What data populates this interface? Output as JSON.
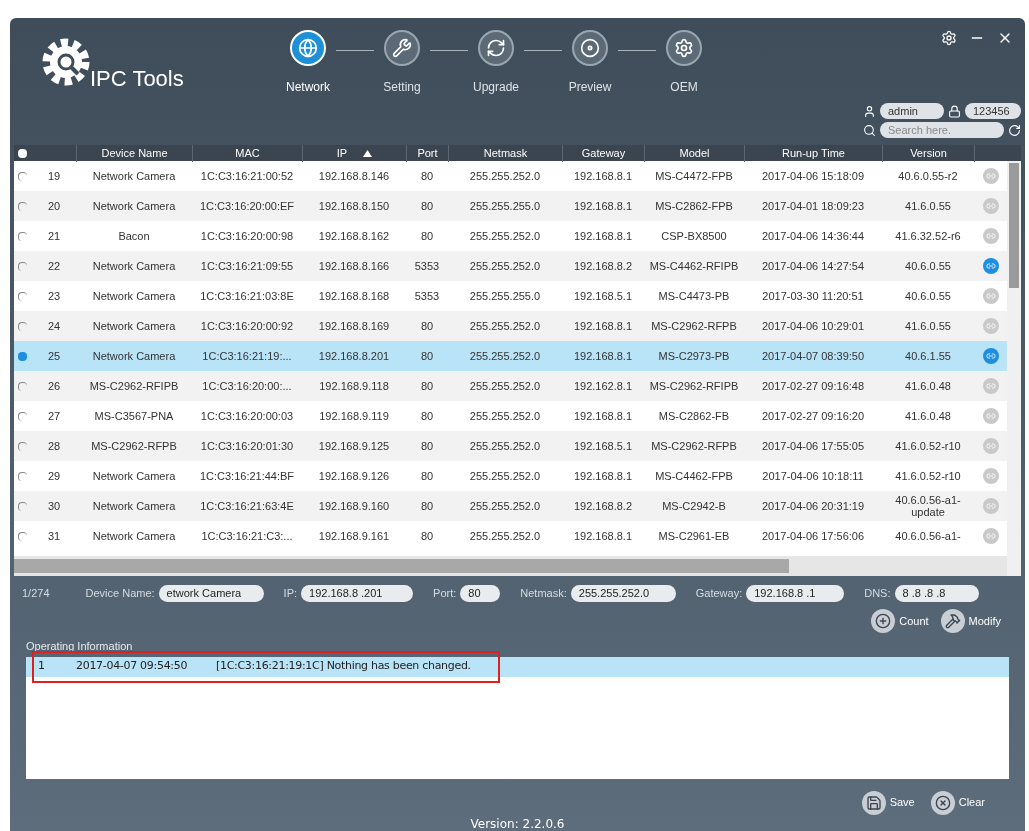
{
  "app": {
    "title": "IPC Tools"
  },
  "steps": [
    {
      "label": "Network",
      "selected": true,
      "kind": "globe"
    },
    {
      "label": "Setting",
      "selected": false,
      "kind": "tools"
    },
    {
      "label": "Upgrade",
      "selected": false,
      "kind": "cycle"
    },
    {
      "label": "Preview",
      "selected": false,
      "kind": "disc"
    },
    {
      "label": "OEM",
      "selected": false,
      "kind": "oem"
    }
  ],
  "login": {
    "username": "admin",
    "password": "123456"
  },
  "search": {
    "placeholder": "Search here."
  },
  "table": {
    "select_all": {
      "checked": false
    },
    "columns": [
      {
        "label": "Device Name",
        "sorted": false
      },
      {
        "label": "MAC",
        "sorted": false
      },
      {
        "label": "IP",
        "sorted": true
      },
      {
        "label": "Port",
        "sorted": false
      },
      {
        "label": "Netmask",
        "sorted": false
      },
      {
        "label": "Gateway",
        "sorted": false
      },
      {
        "label": "Model",
        "sorted": false
      },
      {
        "label": "Run-up Time",
        "sorted": false
      },
      {
        "label": "Version",
        "sorted": false
      }
    ],
    "rows": [
      {
        "no": "19",
        "cells": [
          "Network Camera",
          "1C:C3:16:21:00:52",
          "192.168.8.146",
          "80",
          "255.255.252.0",
          "192.168.8.1",
          "MS-C4472-FPB",
          "2017-04-06 15:18:09",
          "40.6.0.55-r2"
        ],
        "checked": false,
        "selected": false,
        "active": false
      },
      {
        "no": "20",
        "cells": [
          "Network Camera",
          "1C:C3:16:20:00:EF",
          "192.168.8.150",
          "80",
          "255.255.255.0",
          "192.168.8.1",
          "MS-C2862-FPB",
          "2017-04-01 18:09:23",
          "41.6.0.55"
        ],
        "checked": false,
        "selected": false,
        "active": false
      },
      {
        "no": "21",
        "cells": [
          "Bacon",
          "1C:C3:16:20:00:98",
          "192.168.8.162",
          "80",
          "255.255.252.0",
          "192.168.8.1",
          "CSP-BX8500",
          "2017-04-06 14:36:44",
          "41.6.32.52-r6"
        ],
        "checked": false,
        "selected": false,
        "active": false
      },
      {
        "no": "22",
        "cells": [
          "Network Camera",
          "1C:C3:16:21:09:55",
          "192.168.8.166",
          "5353",
          "255.255.252.0",
          "192.168.8.2",
          "MS-C4462-RFIPB",
          "2017-04-06 14:27:54",
          "40.6.0.55"
        ],
        "checked": false,
        "selected": false,
        "active": true
      },
      {
        "no": "23",
        "cells": [
          "Network Camera",
          "1C:C3:16:21:03:8E",
          "192.168.8.168",
          "5353",
          "255.255.255.0",
          "192.168.5.1",
          "MS-C4473-PB",
          "2017-03-30 11:20:51",
          "40.6.0.55"
        ],
        "checked": false,
        "selected": false,
        "active": false
      },
      {
        "no": "24",
        "cells": [
          "Network Camera",
          "1C:C3:16:20:00:92",
          "192.168.8.169",
          "80",
          "255.255.252.0",
          "192.168.8.1",
          "MS-C2962-RFPB",
          "2017-04-06 10:29:01",
          "41.6.0.55"
        ],
        "checked": false,
        "selected": false,
        "active": false
      },
      {
        "no": "25",
        "cells": [
          "Network Camera",
          "1C:C3:16:21:19:...",
          "192.168.8.201",
          "80",
          "255.255.252.0",
          "192.168.8.1",
          "MS-C2973-PB",
          "2017-04-07 08:39:50",
          "40.6.1.55"
        ],
        "checked": true,
        "selected": true,
        "active": true
      },
      {
        "no": "26",
        "cells": [
          "MS-C2962-RFIPB",
          "1C:C3:16:20:00:...",
          "192.168.9.118",
          "80",
          "255.255.252.0",
          "192.162.8.1",
          "MS-C2962-RFIPB",
          "2017-02-27 09:16:48",
          "41.6.0.48"
        ],
        "checked": false,
        "selected": false,
        "active": false
      },
      {
        "no": "27",
        "cells": [
          "MS-C3567-PNA",
          "1C:C3:16:20:00:03",
          "192.168.9.119",
          "80",
          "255.255.252.0",
          "192.168.8.1",
          "MS-C2862-FB",
          "2017-02-27 09:16:20",
          "41.6.0.48"
        ],
        "checked": false,
        "selected": false,
        "active": false
      },
      {
        "no": "28",
        "cells": [
          "MS-C2962-RFPB",
          "1C:C3:16:20:01:30",
          "192.168.9.125",
          "80",
          "255.255.252.0",
          "192.168.5.1",
          "MS-C2962-RFPB",
          "2017-04-06 17:55:05",
          "41.6.0.52-r10"
        ],
        "checked": false,
        "selected": false,
        "active": false
      },
      {
        "no": "29",
        "cells": [
          "Network Camera",
          "1C:C3:16:21:44:BF",
          "192.168.9.126",
          "80",
          "255.255.252.0",
          "192.168.8.1",
          "MS-C4462-FPB",
          "2017-04-06 10:18:11",
          "41.6.0.52-r10"
        ],
        "checked": false,
        "selected": false,
        "active": false
      },
      {
        "no": "30",
        "cells": [
          "Network Camera",
          "1C:C3:16:21:63:4E",
          "192.168.9.160",
          "80",
          "255.255.252.0",
          "192.168.8.2",
          "MS-C2942-B",
          "2017-04-06 20:31:19",
          "40.6.0.56-a1-update"
        ],
        "checked": false,
        "selected": false,
        "active": false
      },
      {
        "no": "31",
        "cells": [
          "Network Camera",
          "1C:C3:16:21:C3:...",
          "192.168.9.161",
          "80",
          "255.255.252.0",
          "192.168.8.1",
          "MS-C2961-EB",
          "2017-04-06 17:56:06",
          "40.6.0.56-a1-"
        ],
        "checked": false,
        "selected": false,
        "active": false
      }
    ]
  },
  "details": {
    "count": "1/274",
    "fields": [
      {
        "label": "Device Name:",
        "value": "etwork Camera"
      },
      {
        "label": "IP:",
        "value": "192.168.8 .201"
      },
      {
        "label": "Port:",
        "value": "80"
      },
      {
        "label": "Netmask:",
        "value": "255.255.252.0"
      },
      {
        "label": "Gateway:",
        "value": "192.168.8 .1"
      },
      {
        "label": "DNS:",
        "value": "8 .8 .8 .8"
      }
    ],
    "buttons": [
      {
        "label": "Count",
        "kind": "count"
      },
      {
        "label": "Modify",
        "kind": "modify"
      }
    ]
  },
  "log": {
    "title": "Operating Information",
    "entries": [
      {
        "no": "1",
        "time": "2017-04-07 09:54:50",
        "message": "[1C:C3:16:21:19:1C] Nothing has been changed.",
        "selected": true,
        "highlighted": true
      }
    ]
  },
  "footer": {
    "buttons": [
      {
        "label": "Save",
        "kind": "save"
      },
      {
        "label": "Clear",
        "kind": "clear"
      }
    ],
    "version": "Version: 2.2.0.6"
  }
}
